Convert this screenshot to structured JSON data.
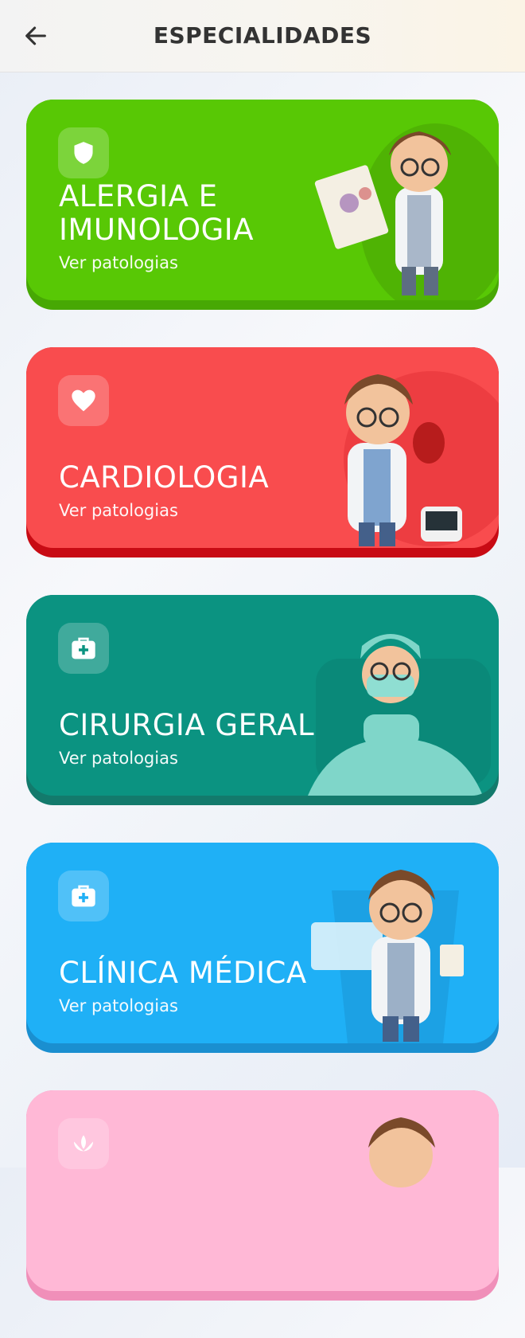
{
  "header": {
    "title": "ESPECIALIDADES",
    "back_icon": "arrow-left-icon"
  },
  "cards": [
    {
      "title": "ALERGIA E IMUNOLOGIA",
      "subtitle": "Ver patologias",
      "icon": "shield-icon",
      "color": "#58c805",
      "shade": "#47a804"
    },
    {
      "title": "CARDIOLOGIA",
      "subtitle": "Ver patologias",
      "icon": "heart-icon",
      "color": "#f94c4e",
      "shade": "#c80b14"
    },
    {
      "title": "CIRURGIA GERAL",
      "subtitle": "Ver patologias",
      "icon": "medical-kit-icon",
      "color": "#0b9381",
      "shade": "#137a6c"
    },
    {
      "title": "CLÍNICA MÉDICA",
      "subtitle": "Ver patologias",
      "icon": "medical-kit-icon",
      "color": "#1fb0f6",
      "shade": "#1a8fd0"
    },
    {
      "title": "",
      "subtitle": "",
      "icon": "lotus-icon",
      "color": "#ffb8d6",
      "shade": "#f08fb9"
    }
  ]
}
